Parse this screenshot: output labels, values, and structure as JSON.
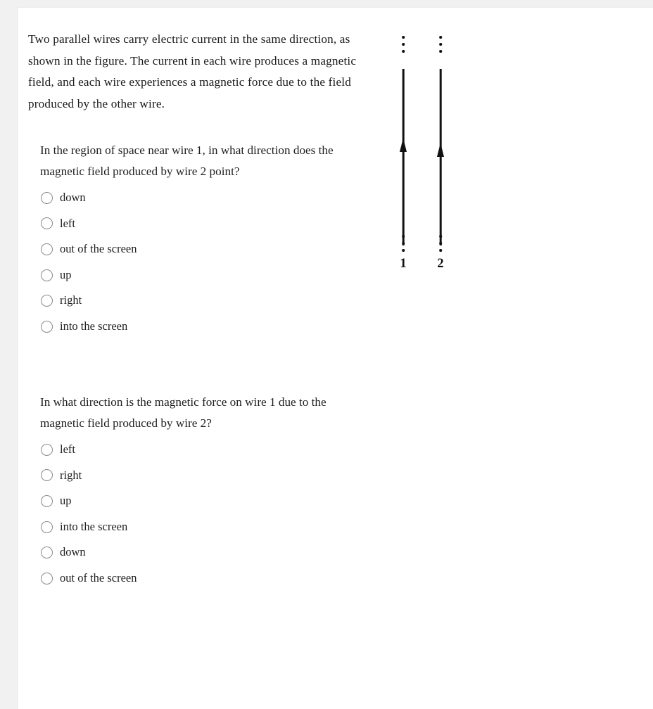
{
  "page": {
    "background_color": "#f1f1f1",
    "card_color": "#ffffff",
    "text_color": "#1f1f1f"
  },
  "intro": {
    "paragraph": "Two parallel wires carry electric current in the same direction, as shown in the figure. The current in each wire produces a magnetic field, and each wire experiences a magnetic force due to the field produced by the other wire."
  },
  "questions": [
    {
      "id": "q1",
      "text": "In the region of space near wire 1, in what direction does the magnetic field produced by wire 2 point?",
      "options": [
        {
          "label": "down",
          "selected": false
        },
        {
          "label": "left",
          "selected": false
        },
        {
          "label": "out of the screen",
          "selected": false
        },
        {
          "label": "up",
          "selected": false
        },
        {
          "label": "right",
          "selected": false
        },
        {
          "label": "into the screen",
          "selected": false
        }
      ]
    },
    {
      "id": "q2",
      "text": "In what direction is the magnetic force on wire 1 due to the magnetic field produced by wire 2?",
      "options": [
        {
          "label": "left",
          "selected": false
        },
        {
          "label": "right",
          "selected": false
        },
        {
          "label": "up",
          "selected": false
        },
        {
          "label": "into the screen",
          "selected": false
        },
        {
          "label": "down",
          "selected": false
        },
        {
          "label": "out of the screen",
          "selected": false
        }
      ]
    }
  ],
  "figure": {
    "description": "Two parallel vertical wires with current arrows pointing upward",
    "line_color": "#111111",
    "wires": [
      {
        "label": "1",
        "current_direction": "up"
      },
      {
        "label": "2",
        "current_direction": "up"
      }
    ]
  }
}
